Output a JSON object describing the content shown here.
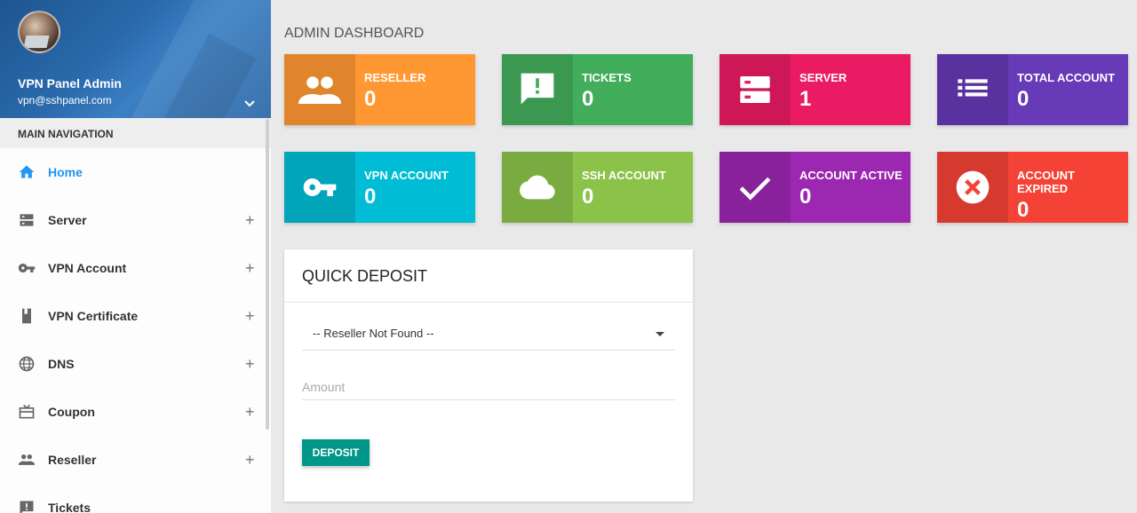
{
  "user": {
    "name": "VPN Panel Admin",
    "email": "vpn@sshpanel.com"
  },
  "nav": {
    "header": "MAIN NAVIGATION",
    "items": [
      {
        "label": "Home",
        "icon": "home-icon",
        "active": true
      },
      {
        "label": "Server",
        "icon": "server-icon"
      },
      {
        "label": "VPN Account",
        "icon": "key-icon"
      },
      {
        "label": "VPN Certificate",
        "icon": "certificate-icon"
      },
      {
        "label": "DNS",
        "icon": "globe-icon"
      },
      {
        "label": "Coupon",
        "icon": "coupon-icon"
      },
      {
        "label": "Reseller",
        "icon": "people-icon"
      },
      {
        "label": "Tickets",
        "icon": "ticket-icon"
      }
    ],
    "expand_symbol": "+"
  },
  "page_title": "ADMIN DASHBOARD",
  "cards": [
    {
      "label": "RESELLER",
      "value": "0",
      "color": "#ff9832",
      "icon": "people-icon"
    },
    {
      "label": "TICKETS",
      "value": "0",
      "color": "#42ae5c",
      "icon": "feedback-icon"
    },
    {
      "label": "SERVER",
      "value": "1",
      "color": "#ea1b63",
      "icon": "server-icon"
    },
    {
      "label": "TOTAL ACCOUNT",
      "value": "0",
      "color": "#673ab7",
      "icon": "list-icon"
    },
    {
      "label": "VPN ACCOUNT",
      "value": "0",
      "color": "#00bcd4",
      "icon": "key-icon"
    },
    {
      "label": "SSH ACCOUNT",
      "value": "0",
      "color": "#8bc34a",
      "icon": "cloud-icon"
    },
    {
      "label": "ACCOUNT ACTIVE",
      "value": "0",
      "color": "#9c27b0",
      "icon": "check-icon"
    },
    {
      "label": "ACCOUNT EXPIRED",
      "value": "0",
      "color": "#f44336",
      "icon": "cancel-icon"
    }
  ],
  "quick_deposit": {
    "title": "QUICK DEPOSIT",
    "select_value": "-- Reseller Not Found --",
    "amount_placeholder": "Amount",
    "button_label": "DEPOSIT"
  }
}
